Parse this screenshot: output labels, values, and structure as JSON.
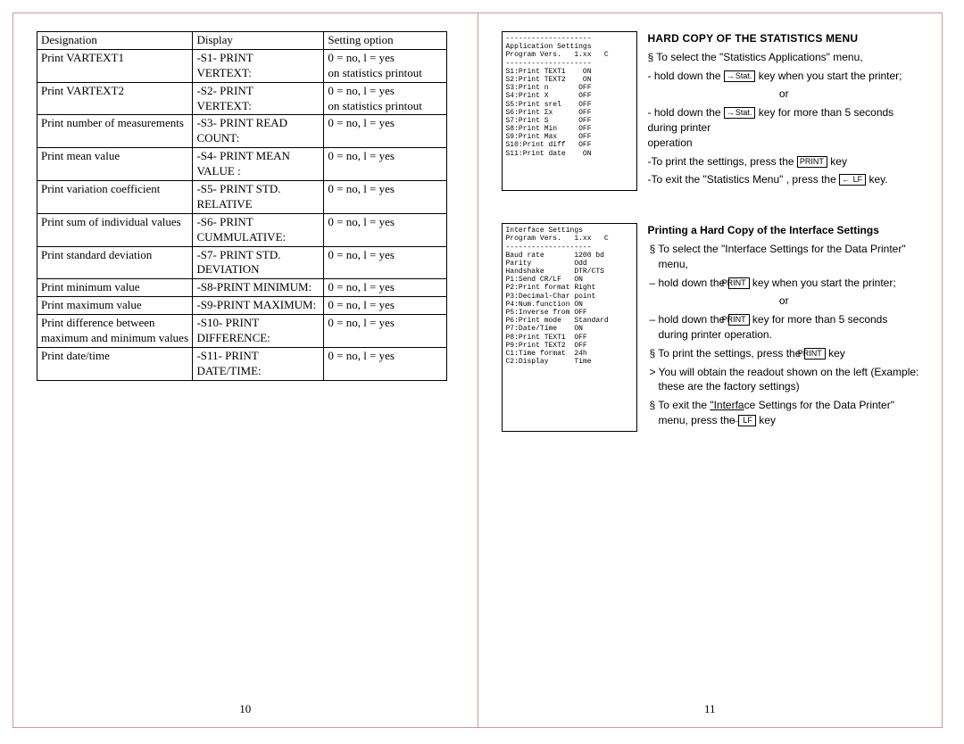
{
  "left": {
    "pageNum": "10",
    "headers": {
      "a": "Designation",
      "b": "Display",
      "c": "Setting option"
    },
    "rows": [
      {
        "a": "Print VARTEXT1",
        "b": "-S1- PRINT\n VERTEXT:",
        "c": "0 = no, l = yes\non statistics printout"
      },
      {
        "a": "Print VARTEXT2",
        "b": "-S2- PRINT\n VERTEXT:",
        "c": "0 = no, l = yes\non statistics printout"
      },
      {
        "a": "Print number of measurements",
        "b": "-S3- PRINT READ COUNT:",
        "c": "0 = no, l = yes"
      },
      {
        "a": "Print mean value",
        "b": "-S4- PRINT MEAN\n  VALUE :",
        "c": "0 = no, l = yes"
      },
      {
        "a": "Print variation coefficient",
        "b": "-S5- PRINT STD. RELATIVE",
        "c": "0 = no, l = yes"
      },
      {
        "a": "Print sum of individual values",
        "b": "-S6- PRINT CUMMULATIVE:",
        "c": "0 = no, l = yes"
      },
      {
        "a": "Print standard deviation",
        "b": "-S7- PRINT STD. DEVIATION",
        "c": "0 = no, l = yes"
      },
      {
        "a": "Print minimum value",
        "b": "-S8-PRINT MINIMUM:",
        "c": "0 = no, l = yes"
      },
      {
        "a": "Print maximum value",
        "b": "-S9-PRINT MAXIMUM:",
        "c": "0 = no, l = yes"
      },
      {
        "a": "Print difference between maximum and minimum values",
        "b": "-S10- PRINT DIFFERENCE:",
        "c": "0 = no, l = yes"
      },
      {
        "a": "Print date/time",
        "b": "-S11- PRINT DATE/TIME:",
        "c": "0 = no, l = yes"
      }
    ]
  },
  "right": {
    "pageNum": "11",
    "section1": {
      "heading": "HARD COPY OF THE STATISTICS MENU",
      "l1a": "§ To select the \"Statistics Applications\" menu,",
      "l2a": " - hold down the ",
      "l2b": " key when you start the printer;",
      "or": "or",
      "l3a": " - hold down the",
      "l3b": " key for more than 5 seconds during printer",
      "l3c": "    operation",
      "l4a": " -To print the settings, press the ",
      "l4b": " key",
      "l5a": " -To exit the \"Statistics Menu\" ,   press the ",
      "l5b": "  key.",
      "btnStat": "Stat.",
      "btnPrint": "PRINT",
      "btnLF": "LF",
      "printout": "--------------------\nApplication Settings\nProgram Vers.   1.xx   C\n--------------------\nS1:Print TEXT1    ON\nS2:Print TEXT2    ON\nS3:Print n       OFF\nS4:Print X       OFF\nS5:Print srel    OFF\nS6:Print Σx      OFF\nS7:Print S       OFF\nS8:Print Min     OFF\nS9:Print Max     OFF\nS10:Print diff   OFF\nS11:Print date    ON"
    },
    "section2": {
      "heading": "Printing a Hard Copy of the Interface Settings",
      "l1": "§  To select the \"Interface Settings for the Data Printer\" menu,",
      "l2a": "–  hold down the ",
      "l2b": " key when you start the printer;",
      "or": "or",
      "l3a": "–  hold down the ",
      "l3b": " key for more than 5 seconds during printer operation.",
      "l4a": "§  To print the settings, press the ",
      "l4b": "  key",
      "l5": ">  You will obtain the readout shown on the left (Example: these are the factory settings)",
      "l6a": "§  To exit the ",
      "l6u": "\"Interfa",
      "l6b": "ce Settings for the Data Printer\" menu, press the ",
      "l6c": " key",
      "btnPrint": "PRINT",
      "btnLF": "LF",
      "printout": "Interface Settings\nProgram Vers.   1.xx   C\n--------------------\nBaud rate       1200 bd\nParity          Odd\nHandshake       DTR/CTS\nP1:Send CR/LF   ON\nP2:Print format Right\nP3:Decimal-Char point\nP4:Num.function ON\nP5:Inverse from OFF\nP6:Print mode   Standard\nP7:Date/Time    ON\nP8:Print TEXT1  OFF\nP9:Print TEXT2  OFF\nC1:Time format  24h\nC2:Display      Time"
    }
  }
}
